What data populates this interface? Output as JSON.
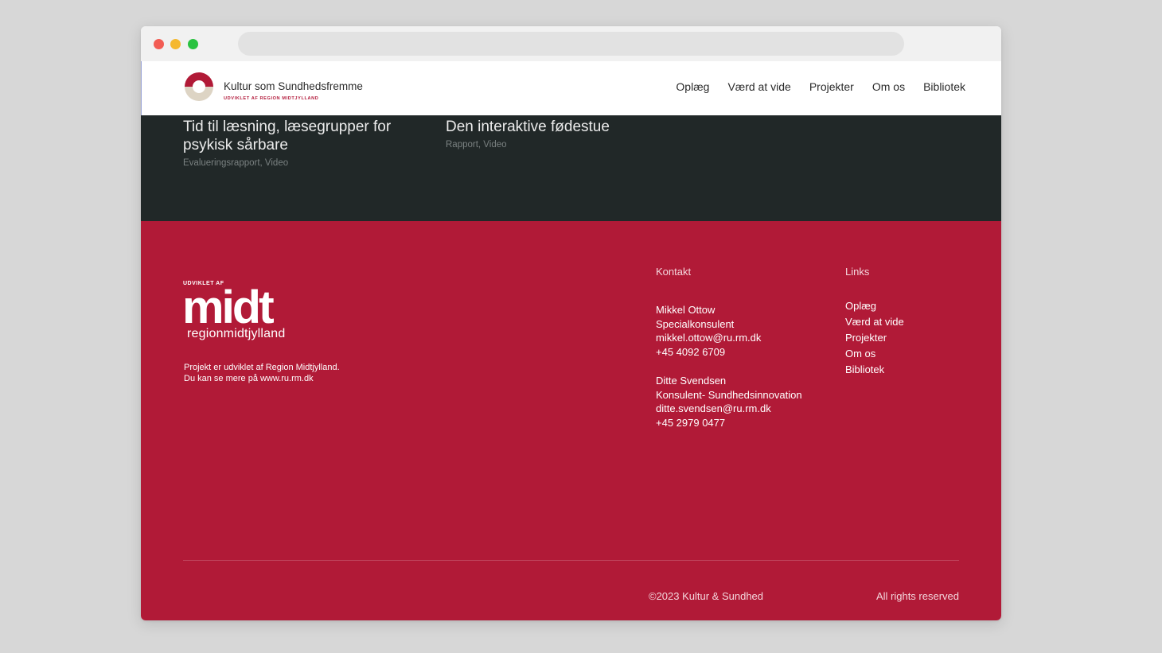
{
  "header": {
    "logo_title": "Kultur som Sundhedsfremme",
    "logo_subtitle": "UDVIKLET AF REGION MIDTJYLLAND",
    "nav": [
      "Oplæg",
      "Værd at vide",
      "Projekter",
      "Om os",
      "Bibliotek"
    ]
  },
  "cards": [
    {
      "title_lines": [
        "Tid til læsning, læsegrupper for",
        "psykisk sårbare"
      ],
      "tags": "Evalueringsrapport, Video"
    },
    {
      "title_lines": [
        "Den interaktive fødestue"
      ],
      "tags": "Rapport, Video"
    }
  ],
  "footer": {
    "kicker": "UDVIKLET AF",
    "logo_word": "midt",
    "logo_region": "regionmidtjylland",
    "description": [
      "Projekt er udviklet af Region Midtjylland.",
      "Du kan se mere på www.ru.rm.dk"
    ],
    "contact_heading": "Kontakt",
    "contacts": [
      {
        "name": "Mikkel Ottow",
        "role": "Specialkonsulent",
        "email": "mikkel.ottow@ru.rm.dk",
        "phone": "+45 4092 6709"
      },
      {
        "name": "Ditte Svendsen",
        "role": "Konsulent- Sundhedsinnovation",
        "email": "ditte.svendsen@ru.rm.dk",
        "phone": "+45 2979 0477"
      }
    ],
    "links_heading": "Links",
    "links": [
      "Oplæg",
      "Værd at vide",
      "Projekter",
      "Om os",
      "Bibliotek"
    ],
    "copyright": "©2023 Kultur & Sundhed",
    "rights": "All rights reserved"
  },
  "colors": {
    "brand_red": "#b11a37",
    "dark_section": "#212828",
    "logo_ring_beige": "#ddd4c4"
  }
}
